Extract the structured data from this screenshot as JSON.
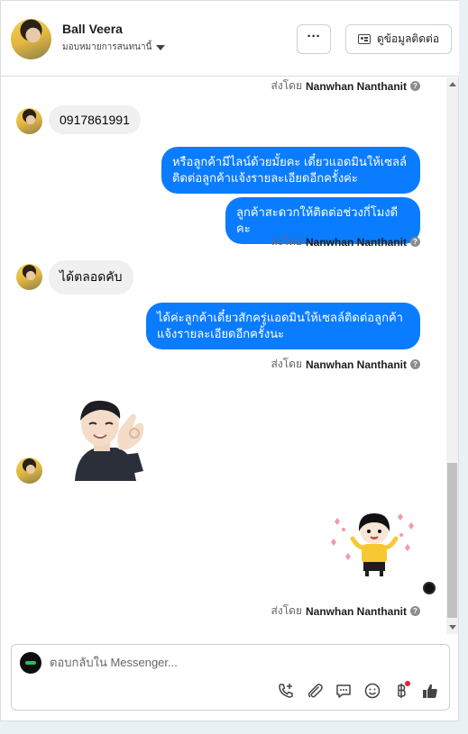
{
  "header": {
    "contact_name": "Ball Veera",
    "assign_label": "มอบหมายการสนทนานี้",
    "more_label": "···",
    "contact_info_label": "ดูข้อมูลติดต่อ"
  },
  "messages": {
    "sent_by_prefix": "ส่งโดย",
    "sender_name": "Nanwhan Nanthanit",
    "in_1": "0917861991",
    "out_1": "หรือลูกค้ามีไลน์ด้วยมั้ยคะ เดี๋ยวแอดมินให้เซลล์ติดต่อลูกค้าแจ้งรายละเอียดอีกครั้งค่ะ",
    "out_2": "ลูกค้าสะดวกให้ติดต่อช่วงกี่โมงดีคะ",
    "in_2": "ได้ตลอดคับ",
    "out_3": "ได้ค่ะลูกค้าเดี๋ยวสักครู่แอดมินให้เซลล์ติดต่อลูกค้าแจ้งรายละเอียดอีกครั้งนะ"
  },
  "composer": {
    "placeholder": "ตอบกลับใน Messenger..."
  },
  "colors": {
    "outgoing_bubble": "#0a7cff",
    "incoming_bubble": "#f0f0f0"
  }
}
